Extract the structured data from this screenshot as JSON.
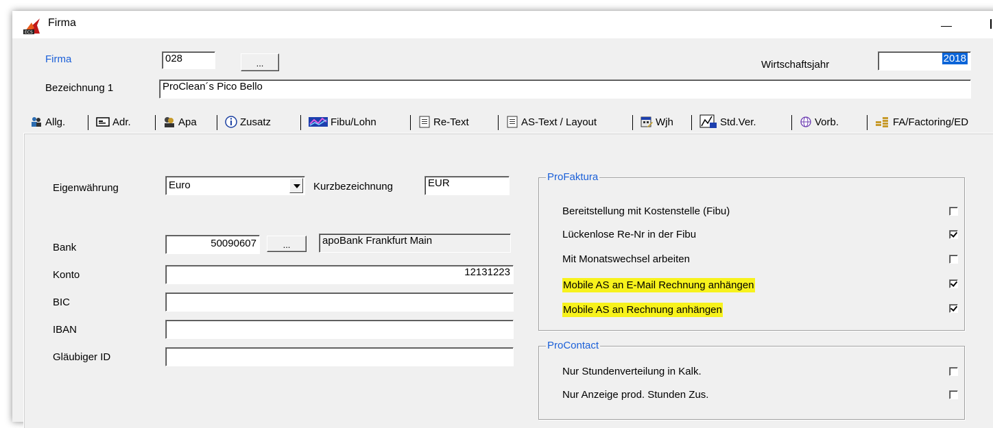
{
  "window": {
    "title": "Firma"
  },
  "header": {
    "firma_label": "Firma",
    "firma_value": "028",
    "browse_label": "...",
    "bezeichnung_label": "Bezeichnung 1",
    "bezeichnung_value": "ProClean´s Pico Bello",
    "wirtschaftsjahr_label": "Wirtschaftsjahr",
    "wirtschaftsjahr_value": "2018"
  },
  "tabs": [
    {
      "label": "Allg.",
      "icon": "people-icon"
    },
    {
      "label": "Adr.",
      "icon": "address-card-icon"
    },
    {
      "label": "Apa",
      "icon": "contacts-icon"
    },
    {
      "label": "Zusatz",
      "icon": "info-icon"
    },
    {
      "label": "Fibu/Lohn",
      "icon": "chart-icon"
    },
    {
      "label": "Re-Text",
      "icon": "document-icon"
    },
    {
      "label": "AS-Text / Layout",
      "icon": "document-icon"
    },
    {
      "label": "Wjh",
      "icon": "calendar-edit-icon"
    },
    {
      "label": "Std.Ver.",
      "icon": "graph-icon"
    },
    {
      "label": "Vorb.",
      "icon": "globe-icon"
    },
    {
      "label": "FA/Factoring/ED",
      "icon": "coins-icon"
    }
  ],
  "allg": {
    "eigenwaehrung_label": "Eigenwährung",
    "eigenwaehrung_value": "Euro",
    "kurz_label": "Kurzbezeichnung",
    "kurz_value": "EUR",
    "bank_label": "Bank",
    "bank_blz": "50090607",
    "bank_browse": "...",
    "bank_name": "apoBank Frankfurt Main",
    "konto_label": "Konto",
    "konto_value": "12131223",
    "bic_label": "BIC",
    "bic_value": "",
    "iban_label": "IBAN",
    "iban_value": "",
    "glaeubiger_label": "Gläubiger ID",
    "glaeubiger_value": ""
  },
  "profaktura": {
    "title": "ProFaktura",
    "items": [
      {
        "label": "Bereitstellung mit Kostenstelle (Fibu)",
        "checked": false,
        "highlight": false
      },
      {
        "label": "Lückenlose Re-Nr in der Fibu",
        "checked": true,
        "highlight": false
      },
      {
        "label": "Mit Monatswechsel arbeiten",
        "checked": false,
        "highlight": false
      },
      {
        "label": "Mobile AS an E-Mail Rechnung anhängen",
        "checked": true,
        "highlight": true
      },
      {
        "label": "Mobile AS an Rechnung anhängen",
        "checked": true,
        "highlight": true
      }
    ]
  },
  "procontact": {
    "title": "ProContact",
    "items": [
      {
        "label": "Nur Stundenverteilung in Kalk.",
        "checked": false
      },
      {
        "label": "Nur Anzeige prod. Stunden Zus.",
        "checked": false
      }
    ]
  },
  "colors": {
    "highlight": "#f7f21c",
    "label_blue": "#1a5fd8",
    "selection": "#0a64d8"
  }
}
